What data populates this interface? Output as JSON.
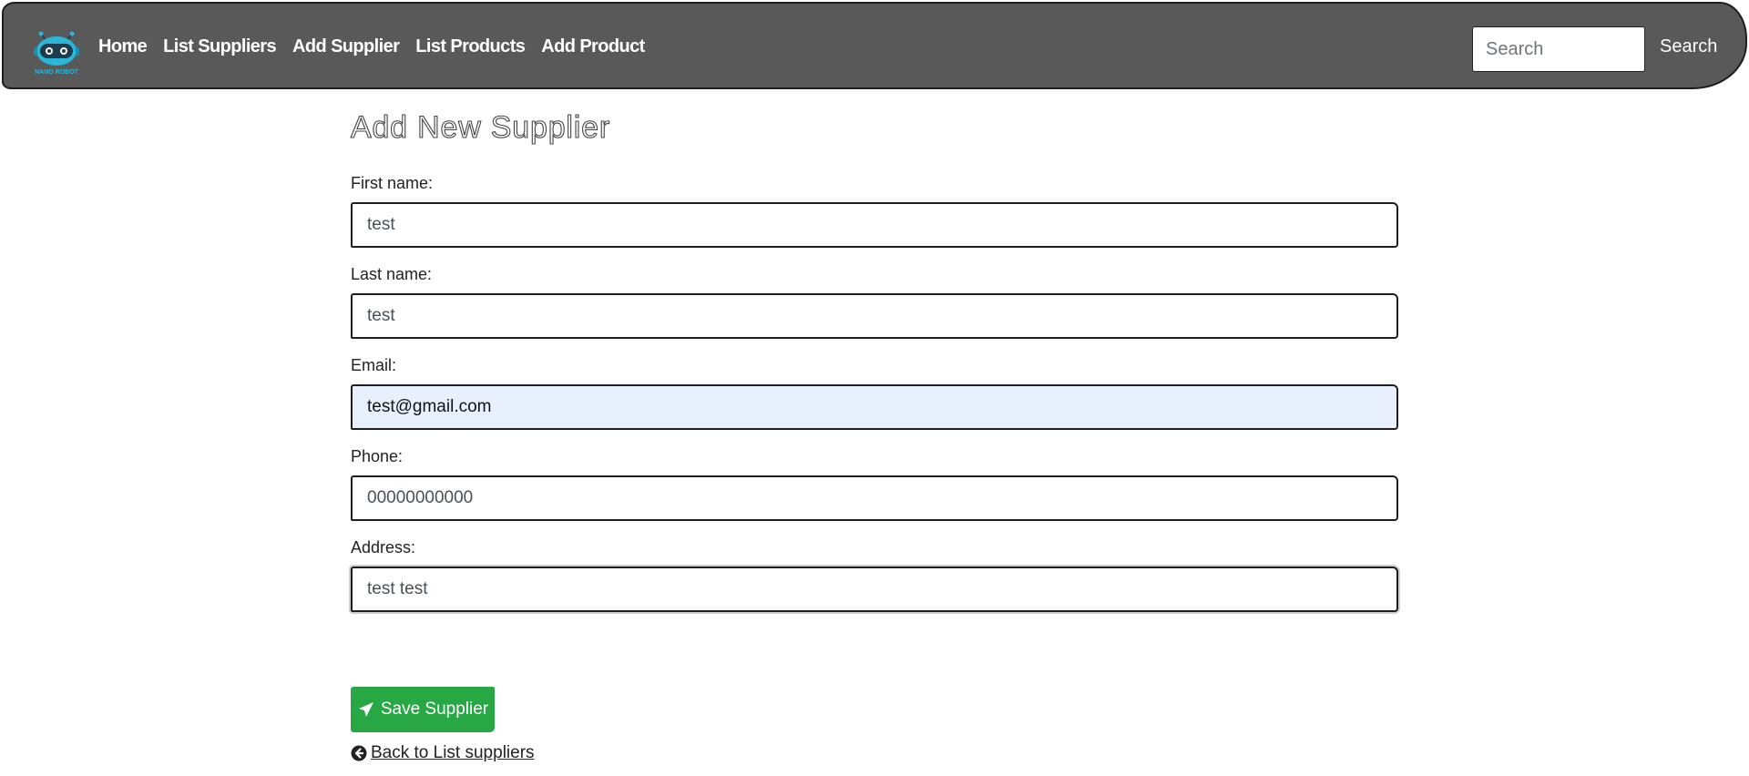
{
  "nav": {
    "logo_text": "NANO ROBOT",
    "links": [
      "Home",
      "List Suppliers",
      "Add Supplier",
      "List Products",
      "Add Product"
    ],
    "search_placeholder": "Search",
    "search_button": "Search"
  },
  "page": {
    "title": "Add New Supplier"
  },
  "form": {
    "first_name": {
      "label": "First name:",
      "value": "test"
    },
    "last_name": {
      "label": "Last name:",
      "value": "test"
    },
    "email": {
      "label": "Email:",
      "value": "test@gmail.com"
    },
    "phone": {
      "label": "Phone:",
      "value": "00000000000"
    },
    "address": {
      "label": "Address:",
      "value": "test test"
    },
    "save_label": "Save Supplier",
    "back_label": "Back to List suppliers"
  },
  "colors": {
    "navbar": "#595959",
    "save_button": "#28a745",
    "autofill_background": "#e8f0fe"
  }
}
